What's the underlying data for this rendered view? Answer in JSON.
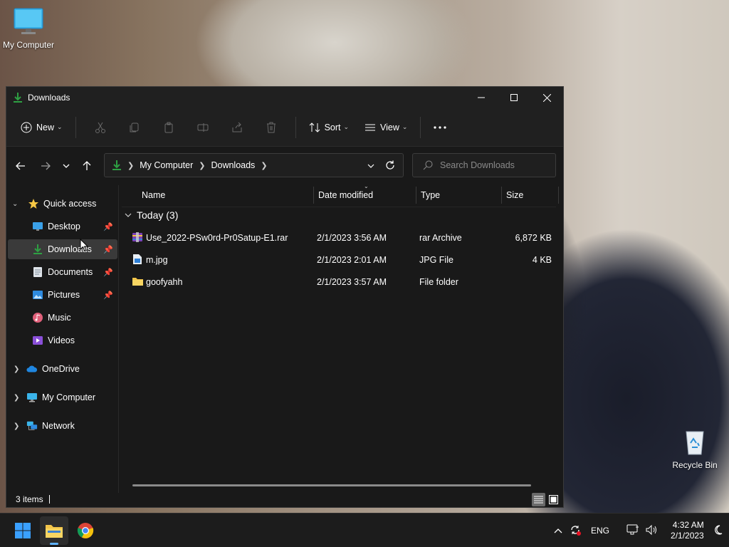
{
  "desktop": {
    "icons": [
      {
        "label": "My Computer",
        "icon": "monitor-icon"
      },
      {
        "label": "Recycle Bin",
        "icon": "recycle-bin-icon"
      }
    ]
  },
  "window": {
    "title": "Downloads",
    "controls": {
      "minimize": "minimize-icon",
      "maximize": "maximize-icon",
      "close": "close-icon"
    }
  },
  "commandbar": {
    "new_label": "New",
    "sort_label": "Sort",
    "view_label": "View",
    "icons": [
      "cut-icon",
      "copy-icon",
      "paste-icon",
      "rename-icon",
      "share-icon",
      "delete-icon",
      "more-icon"
    ]
  },
  "address": {
    "crumbs": [
      "My Computer",
      "Downloads"
    ],
    "search_placeholder": "Search Downloads"
  },
  "navpane": {
    "quick_access": "Quick access",
    "pinned": [
      {
        "label": "Desktop",
        "pinned": true
      },
      {
        "label": "Downloads",
        "pinned": true,
        "selected": true
      },
      {
        "label": "Documents",
        "pinned": true
      },
      {
        "label": "Pictures",
        "pinned": true
      },
      {
        "label": "Music",
        "pinned": false
      },
      {
        "label": "Videos",
        "pinned": false
      }
    ],
    "roots": [
      "OneDrive",
      "My Computer",
      "Network"
    ]
  },
  "filelist": {
    "columns": [
      "Name",
      "Date modified",
      "Type",
      "Size"
    ],
    "group_label": "Today (3)",
    "rows": [
      {
        "name": "Use_2022-PSw0rd-Pr0Satup-E1.rar",
        "date": "2/1/2023 3:56 AM",
        "type": "rar Archive",
        "size": "6,872 KB",
        "icon": "rar-archive-icon"
      },
      {
        "name": "m.jpg",
        "date": "2/1/2023 2:01 AM",
        "type": "JPG File",
        "size": "4 KB",
        "icon": "image-file-icon"
      },
      {
        "name": "goofyahh",
        "date": "2/1/2023 3:57 AM",
        "type": "File folder",
        "size": "",
        "icon": "folder-icon"
      }
    ]
  },
  "statusbar": {
    "items": "3 items"
  },
  "taskbar": {
    "apps": [
      "start-icon",
      "file-explorer-icon",
      "chrome-icon"
    ],
    "language": "ENG",
    "time": "4:32 AM",
    "date": "2/1/2023"
  },
  "colors": {
    "accent": "#0078d4",
    "folder": "#f3c54a",
    "download_green": "#2ea043"
  }
}
